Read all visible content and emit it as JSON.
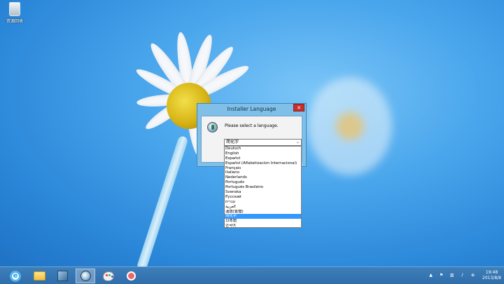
{
  "desktop": {
    "recycle_bin_label": "资源回收"
  },
  "dialog": {
    "title": "Installer Language",
    "close_label": "✕",
    "prompt": "Please select a language.",
    "selected_value": "简化字",
    "languages": [
      "Deutsch",
      "English",
      "Español",
      "Español (Alfabetización Internacional)",
      "Français",
      "Italiano",
      "Nederlands",
      "Português",
      "Português Brasileiro",
      "Svenska",
      "Русский",
      "עברית",
      "العربية",
      "漢語(繁體)",
      "简化字",
      "日本語",
      "한국어"
    ],
    "highlighted_index": 14
  },
  "taskbar": {
    "apps": [
      "internet-explorer",
      "file-explorer",
      "installer-tool",
      "installer-disc",
      "paint",
      "magnifier"
    ],
    "active_app": "installer-disc"
  },
  "tray": {
    "time": "19:48",
    "date": "2013/8/8"
  }
}
